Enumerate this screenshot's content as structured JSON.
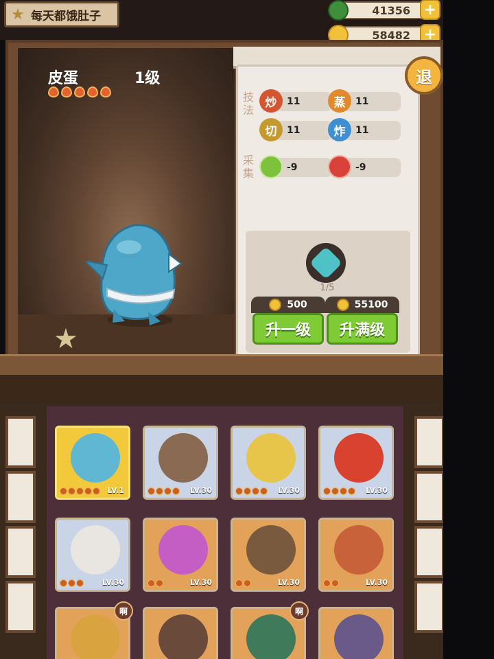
{
  "header": {
    "title": "每天都饿肚子",
    "resources": [
      {
        "name": "green-gem",
        "value": "41356",
        "color": "#3d8f3a"
      },
      {
        "name": "gold-coin",
        "value": "58482",
        "color": "#f2c13a"
      }
    ],
    "plus_label": "+"
  },
  "character": {
    "name": "皮蛋",
    "level": "1级",
    "flames": 5,
    "favorite_label": "收藏"
  },
  "panel": {
    "exit_label": "退",
    "skills_label": "技法",
    "gather_label": "采集",
    "skills": [
      {
        "badge": "炒",
        "value": "11",
        "color": "#d4552f"
      },
      {
        "badge": "蒸",
        "value": "11",
        "color": "#e0892d"
      },
      {
        "badge": "切",
        "value": "11",
        "color": "#c49a2e"
      },
      {
        "badge": "炸",
        "value": "11",
        "color": "#3f8fd3"
      }
    ],
    "gather": [
      {
        "badge": "",
        "value": "-9",
        "color": "#7ec13a",
        "icon": "cabbage-icon"
      },
      {
        "badge": "",
        "value": "-9",
        "color": "#d9423a",
        "icon": "meat-icon"
      }
    ],
    "progress": "1/5",
    "upgrade": {
      "one": {
        "cost": "500",
        "label": "升一级"
      },
      "max": {
        "cost": "55100",
        "label": "升满级"
      }
    }
  },
  "roster": [
    {
      "lv": "LV.1",
      "bg": "#f1c93b",
      "face": "#5fb7d4",
      "flames": 5,
      "selected": true
    },
    {
      "lv": "LV.30",
      "bg": "#c9d4e6",
      "face": "#8a6a52",
      "flames": 4
    },
    {
      "lv": "LV.30",
      "bg": "#c9d4e6",
      "face": "#e7c44a",
      "flames": 4
    },
    {
      "lv": "LV.30",
      "bg": "#c9d4e6",
      "face": "#d8422e",
      "flames": 4
    },
    {
      "lv": "LV.30",
      "bg": "#c9d4e6",
      "face": "#e9e5e0",
      "flames": 3
    },
    {
      "lv": "LV.30",
      "bg": "#e3a25a",
      "face": "#c45ec5",
      "flames": 2
    },
    {
      "lv": "LV.30",
      "bg": "#e3a25a",
      "face": "#7a5a3e",
      "flames": 2
    },
    {
      "lv": "LV.30",
      "bg": "#e3a25a",
      "face": "#c8623a",
      "flames": 2
    },
    {
      "lv": "",
      "bg": "#e3a25a",
      "face": "#d9a440",
      "flames": 0,
      "badge": "啊"
    },
    {
      "lv": "",
      "bg": "#e3a25a",
      "face": "#6a4a3a",
      "flames": 0
    },
    {
      "lv": "",
      "bg": "#e3a25a",
      "face": "#3f7a5a",
      "flames": 0,
      "badge": "啊"
    },
    {
      "lv": "",
      "bg": "#e3a25a",
      "face": "#6a5a8a",
      "flames": 0
    }
  ]
}
